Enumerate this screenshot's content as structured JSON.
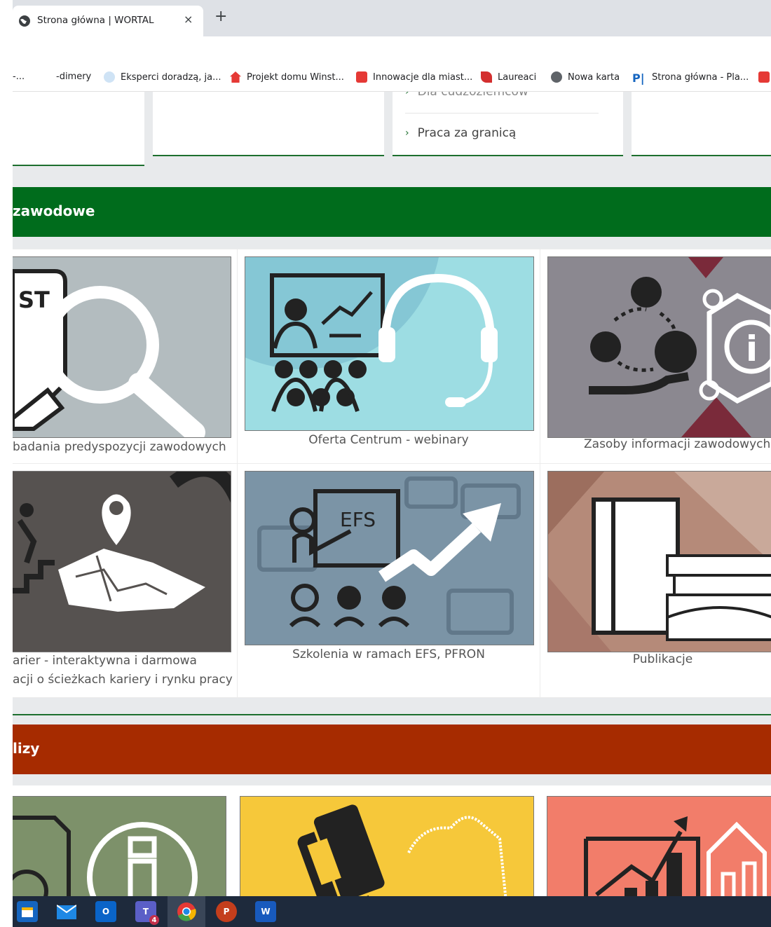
{
  "browser": {
    "tab_title": "Strona główna | WORTAL",
    "close_glyph": "×",
    "new_tab_glyph": "+"
  },
  "bookmarks": [
    {
      "label": "-...",
      "color": "#9e9e9e"
    },
    {
      "label": "-dimery",
      "color": "#9e9e9e"
    },
    {
      "label": "Eksperci doradzą, ja...",
      "color": "#7ab0e0"
    },
    {
      "label": "Projekt domu Winst...",
      "color": "#e53935"
    },
    {
      "label": "Innowacje dla miast...",
      "color": "#e53935"
    },
    {
      "label": "Laureaci",
      "color": "#d32f2f"
    },
    {
      "label": "Nowa karta",
      "color": "#5f6368"
    },
    {
      "label": "Strona główna - Pla...",
      "color": "#1565c0"
    }
  ],
  "top_cards": {
    "items": [
      "Dla cudzoziemców",
      "Praca za granicą"
    ]
  },
  "sections": [
    {
      "title": "zawodowe",
      "color": "#006c1c"
    },
    {
      "title": "lizy",
      "color": "#a62b00"
    }
  ],
  "tiles": [
    {
      "caption": "badania predyspozycji zawodowych",
      "bg": "#b3bcbf",
      "icon": "magnifier-test-icon"
    },
    {
      "caption": "Oferta Centrum - webinary",
      "bg": "#9ddde3",
      "icon": "webinar-headset-icon"
    },
    {
      "caption": "Zasoby informacji zawodowych d",
      "bg": "#8b8890",
      "icon": "info-network-icon"
    },
    {
      "caption_line1": "arier - interaktywna i darmowa",
      "caption_line2": "acji o ścieżkach kariery i rynku pracy",
      "bg": "#565250",
      "icon": "career-map-icon"
    },
    {
      "caption": "Szkolenia w ramach EFS, PFRON",
      "bg": "#7b94a6",
      "icon": "training-efs-icon",
      "efs_text": "EFS"
    },
    {
      "caption": "Publikacje",
      "bg": "#b58a79",
      "icon": "books-icon"
    },
    {
      "bg": "#7d916a",
      "icon": "document-info-icon"
    },
    {
      "bg": "#f6c83a",
      "icon": "region-map-icon"
    },
    {
      "bg": "#f27d6a",
      "icon": "analytics-chart-icon"
    }
  ],
  "taskbar": [
    {
      "name": "calendar-app",
      "color": "#1565c0"
    },
    {
      "name": "mail-app",
      "color": "#1e88e5"
    },
    {
      "name": "outlook-app",
      "color": "#0a64c8",
      "letter": "O"
    },
    {
      "name": "teams-app",
      "color": "#5b5fc7",
      "letter": "T",
      "badge": "4"
    },
    {
      "name": "chrome-app",
      "color": "#f5b400"
    },
    {
      "name": "powerpoint-app",
      "color": "#c43e1c",
      "letter": "P"
    },
    {
      "name": "word-app",
      "color": "#185abd",
      "letter": "W"
    }
  ]
}
